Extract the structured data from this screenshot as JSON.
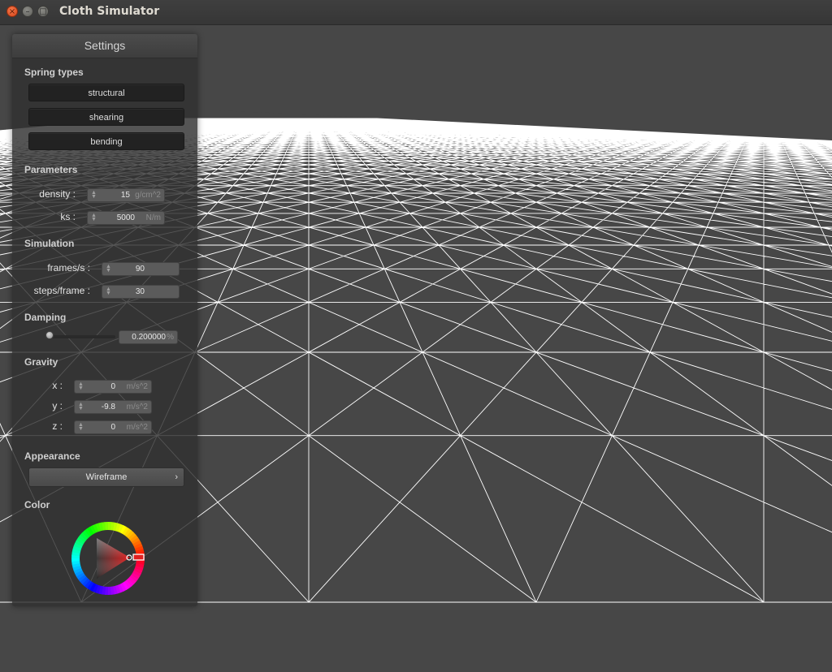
{
  "window": {
    "title": "Cloth Simulator",
    "close_glyph": "×",
    "minimize_glyph": "–",
    "maximize_glyph": "□"
  },
  "settings": {
    "header": "Settings",
    "spring_types": {
      "label": "Spring types",
      "buttons": [
        "structural",
        "shearing",
        "bending"
      ]
    },
    "parameters": {
      "label": "Parameters",
      "density": {
        "label": "density :",
        "value": "15",
        "unit": "g/cm^2"
      },
      "ks": {
        "label": "ks :",
        "value": "5000",
        "unit": "N/m"
      }
    },
    "simulation": {
      "label": "Simulation",
      "frames": {
        "label": "frames/s :",
        "value": "90"
      },
      "steps": {
        "label": "steps/frame :",
        "value": "30"
      }
    },
    "damping": {
      "label": "Damping",
      "value": "0.200000",
      "unit": "%",
      "slider_fraction": 0.0
    },
    "gravity": {
      "label": "Gravity",
      "x": {
        "label": "x :",
        "value": "0",
        "unit": "m/s^2"
      },
      "y": {
        "label": "y :",
        "value": "-9.8",
        "unit": "m/s^2"
      },
      "z": {
        "label": "z :",
        "value": "0",
        "unit": "m/s^2"
      }
    },
    "appearance": {
      "label": "Appearance",
      "selected": "Wireframe",
      "chevron": "›"
    },
    "color": {
      "label": "Color",
      "selected_color": "#e02020"
    }
  },
  "viewport": {
    "background": "#474747",
    "mesh_color": "#ffffff",
    "render_mode": "wireframe"
  }
}
